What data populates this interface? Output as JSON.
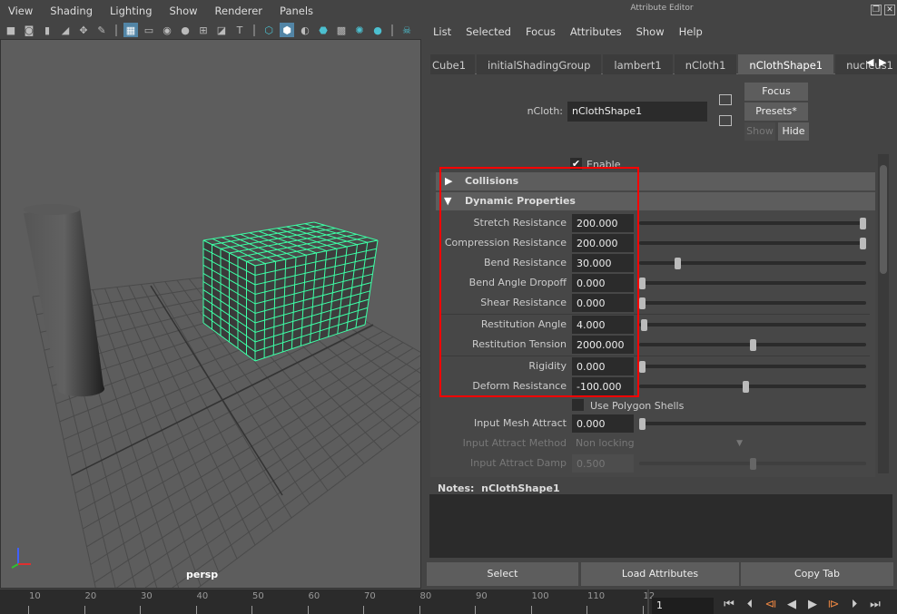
{
  "viewport": {
    "menu": [
      "View",
      "Shading",
      "Lighting",
      "Show",
      "Renderer",
      "Panels"
    ],
    "tools": [
      {
        "icon": "camera-icon",
        "on": false
      },
      {
        "icon": "camera-attributes-icon",
        "on": false
      },
      {
        "icon": "bookmark-icon",
        "on": false
      },
      {
        "icon": "image-plane-icon",
        "on": false
      },
      {
        "icon": "move-camera-icon",
        "on": false
      },
      {
        "icon": "paint-icon",
        "on": false
      },
      {
        "sep": true
      },
      {
        "icon": "grid-icon",
        "on": true
      },
      {
        "icon": "film-gate-icon",
        "on": false
      },
      {
        "icon": "resolution-gate-icon",
        "on": false
      },
      {
        "icon": "gate-mask-icon",
        "on": false
      },
      {
        "icon": "field-chart-icon",
        "on": false
      },
      {
        "icon": "safe-action-icon",
        "on": false
      },
      {
        "icon": "safe-title-icon",
        "on": false
      },
      {
        "sep": true
      },
      {
        "icon": "wireframe-icon",
        "on": false
      },
      {
        "icon": "smooth-shade-icon",
        "on": true
      },
      {
        "icon": "default-material-icon",
        "on": false
      },
      {
        "icon": "wireframe-on-shaded-icon",
        "on": false
      },
      {
        "icon": "textured-icon",
        "on": false
      },
      {
        "icon": "lights-icon",
        "on": false
      },
      {
        "icon": "shadows-icon",
        "on": false
      },
      {
        "sep": true
      },
      {
        "icon": "xray-icon",
        "on": false
      }
    ],
    "camera_label": "persp",
    "wire_color": "#3dffa6"
  },
  "attribute_editor": {
    "title": "Attribute Editor",
    "menu": [
      "List",
      "Selected",
      "Focus",
      "Attributes",
      "Show",
      "Help"
    ],
    "tabs": [
      {
        "label": "Cube1",
        "active": false
      },
      {
        "label": "initialShadingGroup",
        "active": false
      },
      {
        "label": "lambert1",
        "active": false
      },
      {
        "label": "nCloth1",
        "active": false
      },
      {
        "label": "nClothShape1",
        "active": true
      },
      {
        "label": "nucleus1",
        "active": false
      }
    ],
    "node_label": "nCloth:",
    "node_value": "nClothShape1",
    "focus": "Focus",
    "presets": "Presets*",
    "show": "Show",
    "hide": "Hide",
    "enable": "Enable",
    "collisions": "Collisions",
    "dynamic_properties": "Dynamic Properties",
    "attrs": [
      {
        "label": "Stretch Resistance",
        "value": "200.000",
        "slider": 1.0
      },
      {
        "label": "Compression Resistance",
        "value": "200.000",
        "slider": 1.0
      },
      {
        "label": "Bend Resistance",
        "value": "30.000",
        "slider": 0.16
      },
      {
        "label": "Bend Angle Dropoff",
        "value": "0.000",
        "slider": 0.0
      },
      {
        "label": "Shear Resistance",
        "value": "0.000",
        "slider": 0.0
      },
      {
        "label": "Restitution Angle",
        "value": "4.000",
        "slider": 0.01
      },
      {
        "label": "Restitution Tension",
        "value": "2000.000",
        "slider": 0.5
      },
      {
        "label": "Rigidity",
        "value": "0.000",
        "slider": 0.0
      },
      {
        "label": "Deform Resistance",
        "value": "-100.000",
        "slider": 0.47
      }
    ],
    "use_polygon_shells": "Use Polygon Shells",
    "input_mesh_attract": {
      "label": "Input Mesh Attract",
      "value": "0.000",
      "slider": 0.0
    },
    "input_attract_method": {
      "label": "Input Attract Method",
      "value": "Non locking"
    },
    "input_attract_damp": {
      "label": "Input Attract Damp",
      "value": "0.500",
      "slider": 0.5
    },
    "notes_label": "Notes:",
    "notes_node": "nClothShape1",
    "buttons": [
      "Select",
      "Load Attributes",
      "Copy Tab"
    ],
    "highlight_color": "#ff0000"
  },
  "timeline": {
    "ticks": [
      "10",
      "20",
      "30",
      "40",
      "50",
      "60",
      "70",
      "80",
      "90",
      "100",
      "110",
      "12"
    ],
    "current_frame": "1",
    "controls": [
      "go-to-start-icon",
      "step-back-icon",
      "step-back-key-icon",
      "play-backwards-icon",
      "play-forwards-icon",
      "step-forward-key-icon",
      "step-forward-icon",
      "go-to-end-icon"
    ]
  }
}
